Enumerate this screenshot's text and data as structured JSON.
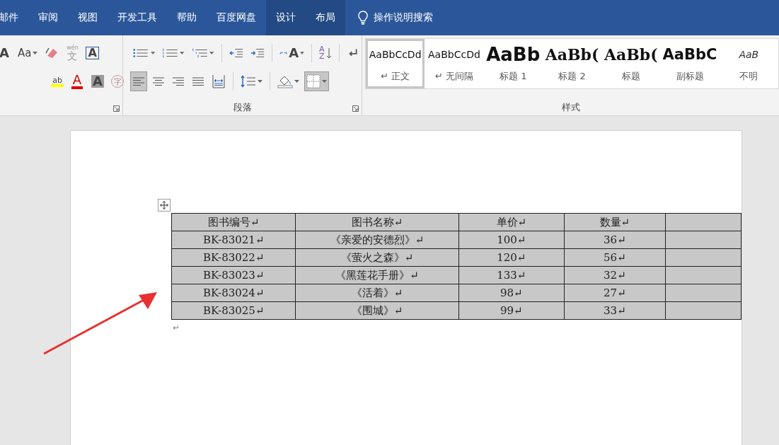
{
  "tabs": [
    {
      "label": "邮件",
      "contextual": false
    },
    {
      "label": "审阅",
      "contextual": false
    },
    {
      "label": "视图",
      "contextual": false
    },
    {
      "label": "开发工具",
      "contextual": false
    },
    {
      "label": "帮助",
      "contextual": false
    },
    {
      "label": "百度网盘",
      "contextual": false
    },
    {
      "label": "设计",
      "contextual": true
    },
    {
      "label": "布局",
      "contextual": true
    }
  ],
  "tell_me": {
    "placeholder": "操作说明搜索"
  },
  "font_group": {
    "row1": [
      {
        "kind": "grow",
        "glyph": "A"
      },
      {
        "kind": "case",
        "glyph": "Aa"
      },
      {
        "kind": "eraser"
      },
      {
        "kind": "phonetic",
        "glyph": "文",
        "ruby": "wén"
      },
      {
        "kind": "boxed",
        "glyph": "A"
      }
    ],
    "row2": [
      {
        "kind": "highlight",
        "glyph": "ab"
      },
      {
        "kind": "font_color",
        "glyph": "A"
      },
      {
        "kind": "shaded",
        "glyph": "A"
      },
      {
        "kind": "enclosed",
        "glyph": "字"
      }
    ]
  },
  "paragraph_group": {
    "title": "段落",
    "row1": [
      {
        "kind": "bullets",
        "pressed": false
      },
      {
        "kind": "numbering",
        "pressed": false
      },
      {
        "kind": "multilevel",
        "pressed": false
      },
      {
        "kind": "outdent",
        "pressed": false
      },
      {
        "kind": "indent",
        "pressed": false
      },
      {
        "kind": "layout",
        "glyph": "A",
        "pressed": false
      },
      {
        "kind": "sort",
        "glyph": "A",
        "glyph2": "Z",
        "pressed": false
      },
      {
        "kind": "marks",
        "pressed": false
      }
    ],
    "row2": [
      {
        "kind": "align_left",
        "pressed": true
      },
      {
        "kind": "align_center",
        "pressed": false
      },
      {
        "kind": "align_right",
        "pressed": false
      },
      {
        "kind": "justify",
        "pressed": false
      },
      {
        "kind": "distribute",
        "pressed": false
      },
      {
        "kind": "line_spacing",
        "pressed": false
      },
      {
        "kind": "shading",
        "pressed": false
      },
      {
        "kind": "borders",
        "pressed": true
      }
    ]
  },
  "styles_group": {
    "title": "样式",
    "items": [
      {
        "kind": "normal",
        "preview": "AaBbCcDd",
        "label": "↵ 正文",
        "selected": true
      },
      {
        "kind": "no_spacing",
        "preview": "AaBbCcDd",
        "label": "↵ 无间隔",
        "selected": false
      },
      {
        "kind": "heading1",
        "preview": "AaBb",
        "label": "标题 1",
        "selected": false
      },
      {
        "kind": "heading2",
        "preview": "AaBb(",
        "label": "标题 2",
        "selected": false
      },
      {
        "kind": "title",
        "preview": "AaBb(",
        "label": "标题",
        "selected": false
      },
      {
        "kind": "subtitle",
        "preview": "AaBbC",
        "label": "副标题",
        "selected": false
      },
      {
        "kind": "emphasis",
        "preview": "AaB",
        "label": "不明",
        "selected": false
      }
    ]
  },
  "table": {
    "columns": [
      "图书编号↵",
      "图书名称↵",
      "单价↵",
      "数量↵"
    ],
    "rows": [
      [
        "BK-83021↵",
        "《亲爱的安德烈》↵",
        "100↵",
        "36↵"
      ],
      [
        "BK-83022↵",
        "《萤火之森》↵",
        "120↵",
        "56↵"
      ],
      [
        "BK-83023↵",
        "《黑莲花手册》↵",
        "133↵",
        "32↵"
      ],
      [
        "BK-83024↵",
        "《活着》↵",
        "98↵",
        "27↵"
      ],
      [
        "BK-83025↵",
        "《围城》↵",
        "99↵",
        "33↵"
      ]
    ]
  },
  "after_table_mark": "↵"
}
